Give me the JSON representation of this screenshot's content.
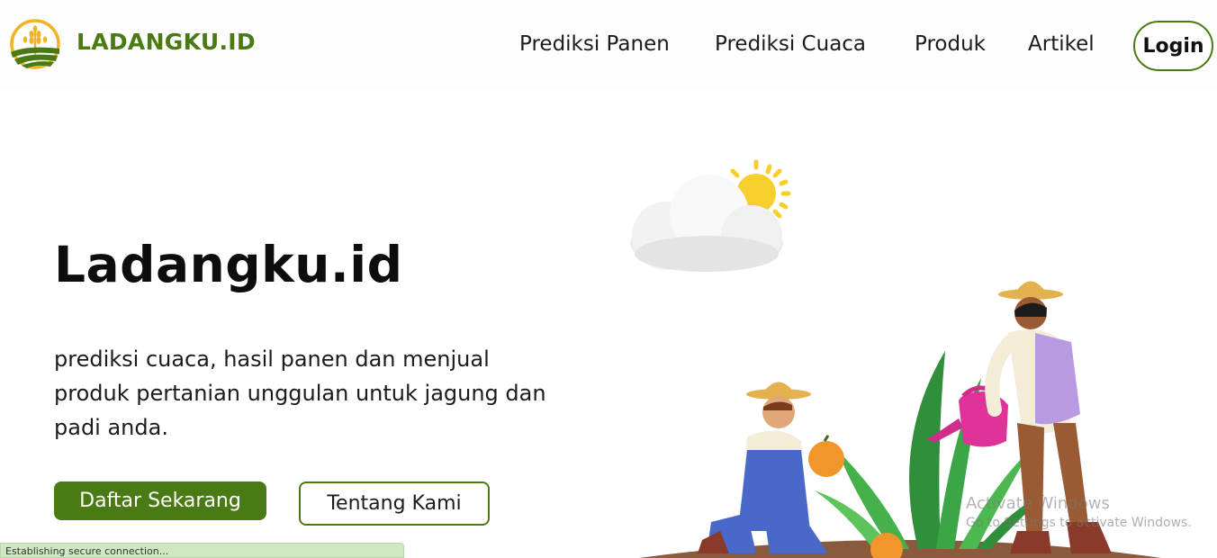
{
  "header": {
    "brand": "LADANGKU.ID",
    "nav": [
      "Prediksi Panen",
      "Prediksi Cuaca",
      "Produk",
      "Artikel"
    ],
    "login_label": "Login"
  },
  "hero": {
    "title": "Ladangku.id",
    "description": "prediksi cuaca, hasil panen dan menjual produk pertanian unggulan untuk jagung dan padi anda.",
    "primary_button": "Daftar Sekarang",
    "secondary_button": "Tentang Kami"
  },
  "status": {
    "text": "Establishing secure connection..."
  },
  "watermark": {
    "title": "Activate Windows",
    "subtitle": "Go to Settings to activate Windows."
  },
  "colors": {
    "brand_green": "#4a7a14",
    "status_bg": "#cfe8c3"
  },
  "icons": {
    "logo": "wheat-field-logo-icon"
  }
}
